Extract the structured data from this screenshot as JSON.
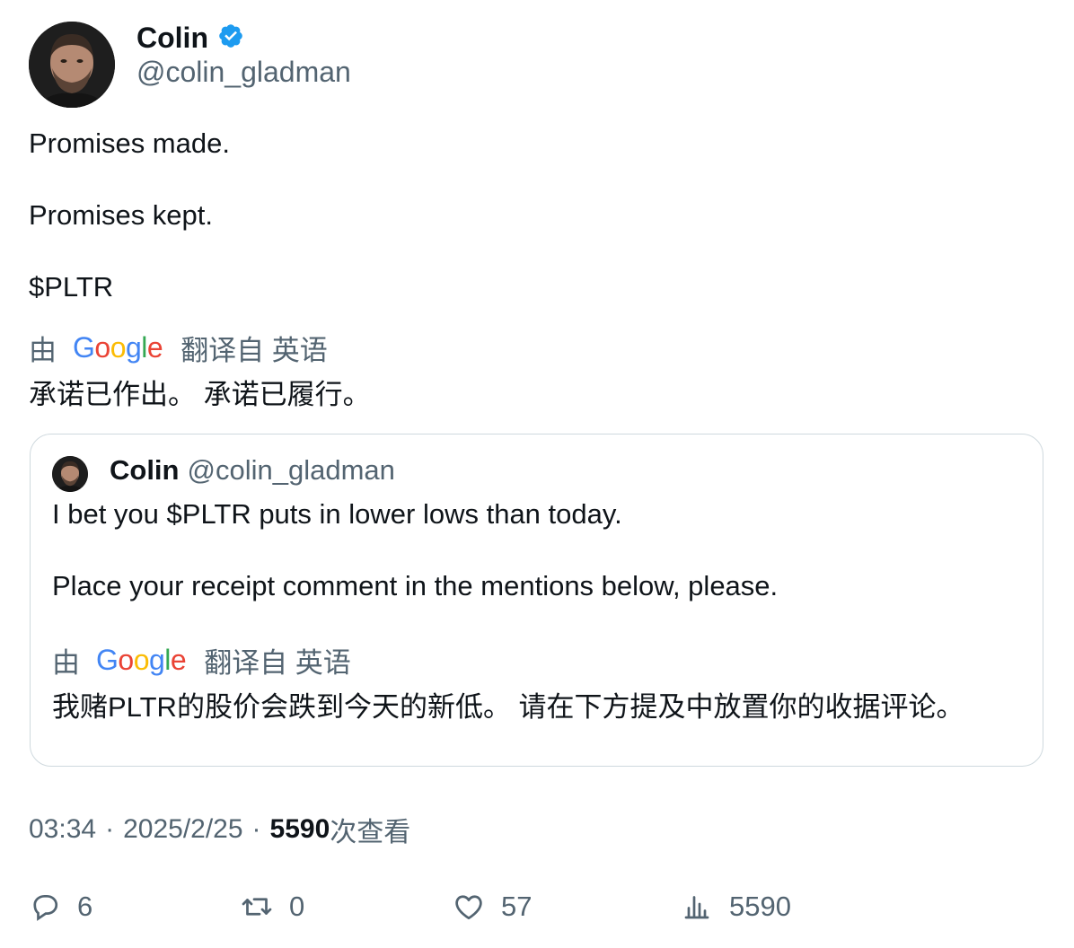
{
  "author": {
    "name": "Colin",
    "handle": "@colin_gladman",
    "verified_icon": "verified-badge-icon"
  },
  "tweet": {
    "lines": [
      "Promises made.",
      "Promises kept.",
      "$PLTR"
    ],
    "translation_prefix": "由",
    "translation_provider": "Google",
    "translation_suffix": "翻译自 英语",
    "translation_text": "承诺已作出。 承诺已履行。"
  },
  "quoted_tweet": {
    "name": "Colin",
    "handle": "@colin_gladman",
    "lines": [
      "I bet you $PLTR puts in lower lows than today.",
      "Place your receipt comment in the mentions below, please."
    ],
    "translation_prefix": "由",
    "translation_provider": "Google",
    "translation_suffix": "翻译自 英语",
    "translation_text": "我赌PLTR的股价会跌到今天的新低。 请在下方提及中放置你的收据评论。"
  },
  "meta": {
    "time": "03:34",
    "separator": "·",
    "date": "2025/2/25",
    "views_count": "5590",
    "views_label": "次查看"
  },
  "actions": {
    "replies": "6",
    "reposts": "0",
    "likes": "57",
    "views": "5590"
  },
  "colors": {
    "text": "#0f1419",
    "secondary": "#536471",
    "verified": "#1d9bf0",
    "border": "#cfd9de"
  }
}
